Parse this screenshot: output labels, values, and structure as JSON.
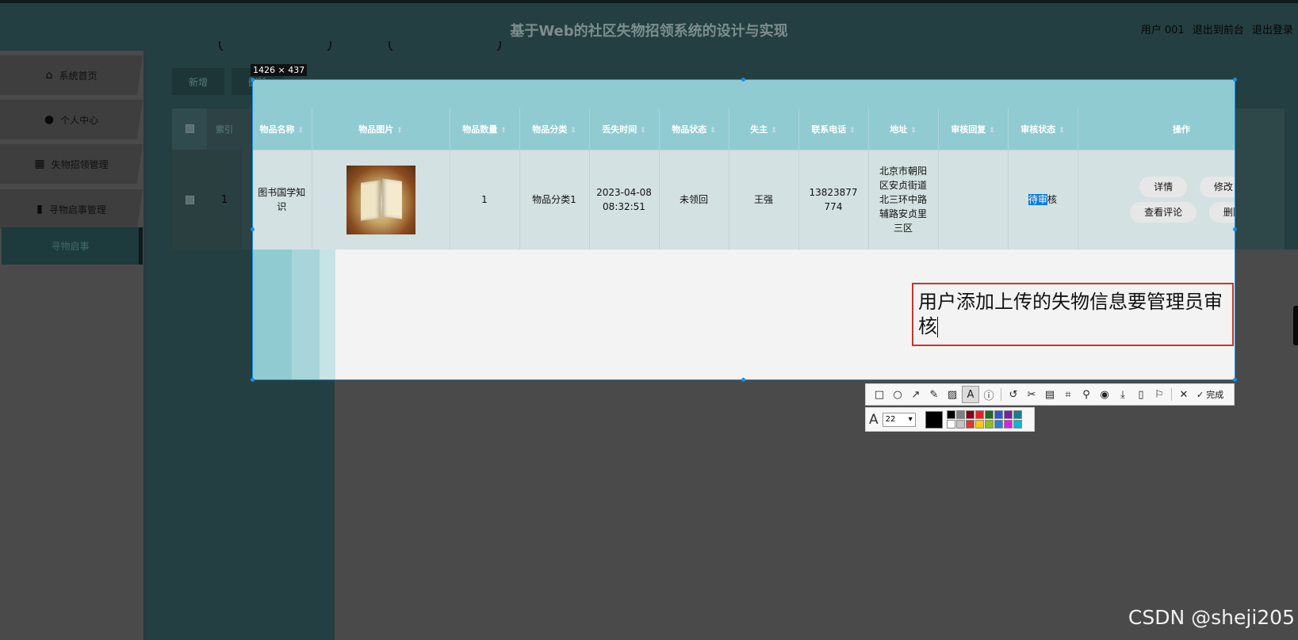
{
  "header": {
    "title": "基于Web的社区失物招领系统的设计与实现",
    "user": "用户 001",
    "back_to_front": "退出到前台",
    "logout": "退出登录"
  },
  "sidebar": {
    "items": [
      {
        "label": "系统首页",
        "icon": "home-icon"
      },
      {
        "label": "个人中心",
        "icon": "user-icon"
      },
      {
        "label": "失物招领管理",
        "icon": "grid-icon"
      },
      {
        "label": "寻物启事管理",
        "icon": "clipboard-icon"
      }
    ],
    "sub_item": "寻物启事"
  },
  "toolbar": {
    "add_label": "新增",
    "delete_label": "删除"
  },
  "selection": {
    "size_label": "1426 × 437"
  },
  "table": {
    "headers": [
      "索引",
      "物品名称",
      "物品图片",
      "物品数量",
      "物品分类",
      "丢失时间",
      "物品状态",
      "失主",
      "联系电话",
      "地址",
      "审核回复",
      "审核状态",
      "操作"
    ],
    "row": {
      "index": "1",
      "name": "图书国学知识",
      "quantity": "1",
      "category": "物品分类1",
      "lost_time": "2023-04-08 08:32:51",
      "status": "未领回",
      "owner": "王强",
      "phone": "13823877774",
      "address": "北京市朝阳区安贞街道北三环中路辅路安贞里三区",
      "reply": "",
      "review_status_highlight": "待审",
      "review_status_rest": "核"
    },
    "actions": {
      "detail": "详情",
      "edit": "修改",
      "comments": "查看评论",
      "delete": "删除"
    }
  },
  "annotation": {
    "text": "用户添加上传的失物信息要管理员审核"
  },
  "screenshot_tool": {
    "tools": [
      "rect-icon",
      "ellipse-icon",
      "arrow-icon",
      "pen-icon",
      "mosaic-icon",
      "text-icon",
      "number-icon",
      "undo-icon",
      "scissors-icon",
      "ocr-icon",
      "scan-icon",
      "pin-icon",
      "record-icon",
      "download-icon",
      "phone-icon",
      "bookmark-icon",
      "close-icon"
    ],
    "done_label": "完成",
    "font_size": "22",
    "palette": [
      "#000000",
      "#7f7f7f",
      "#880015",
      "#ed1c24",
      "#1f6b1f",
      "#2f57c9",
      "#7a1fa2",
      "#15808c",
      "#ffffff",
      "#c3c3c3",
      "#d93a2b",
      "#ffc90e",
      "#8fbf1f",
      "#2a7fd9",
      "#e020e0",
      "#12b6c8"
    ],
    "current_color": "#000000"
  },
  "watermark": "CSDN @sheji205"
}
